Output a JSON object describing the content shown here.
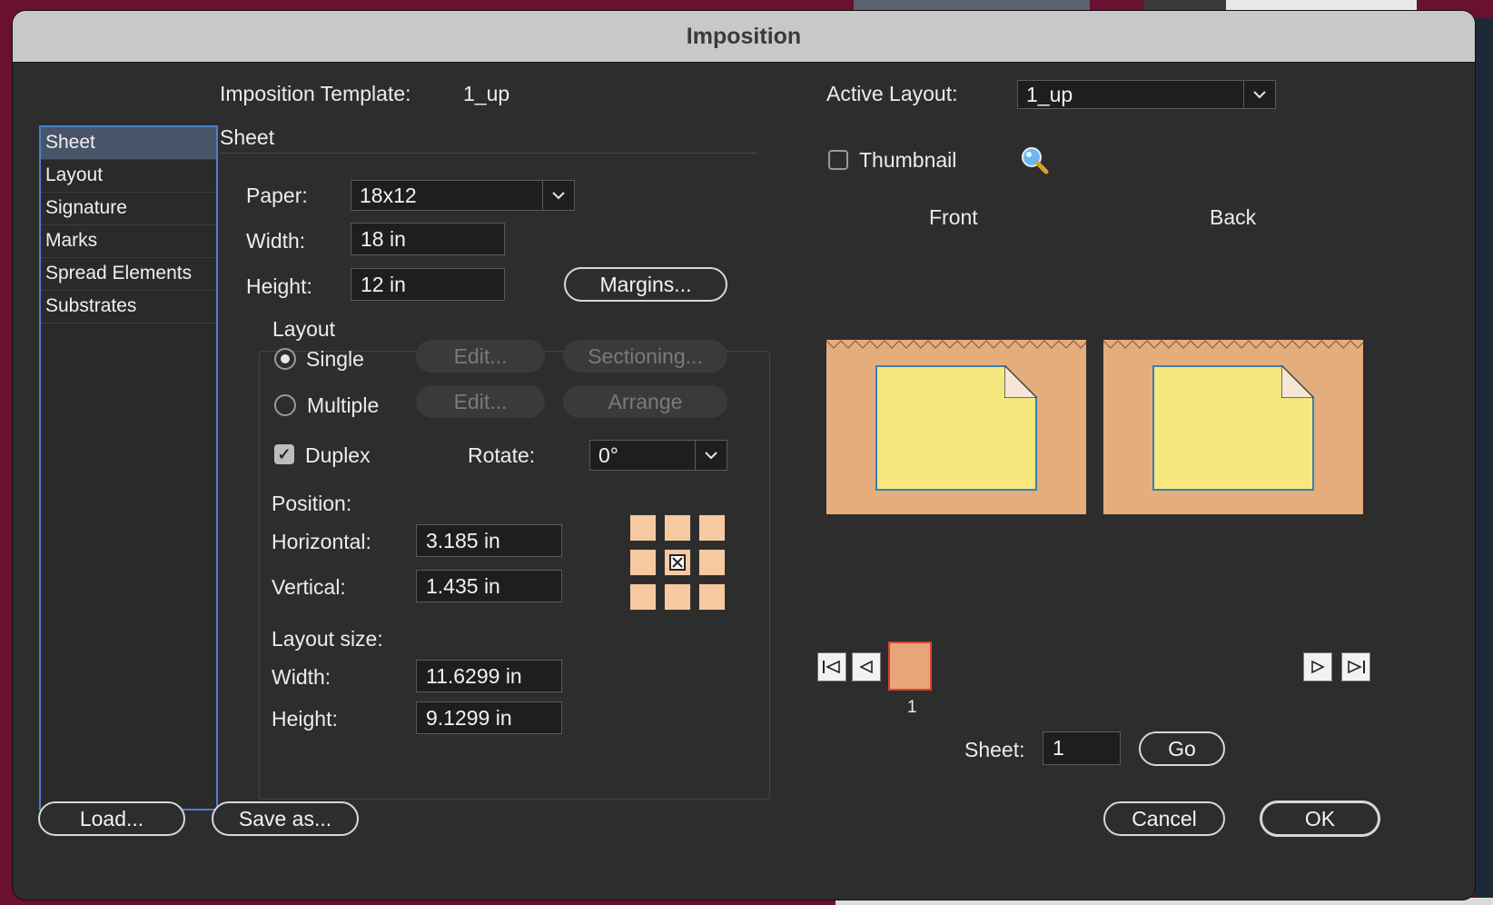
{
  "dialog": {
    "title": "Imposition"
  },
  "template": {
    "label": "Imposition Template:",
    "value": "1_up"
  },
  "active_layout": {
    "label": "Active Layout:",
    "value": "1_up"
  },
  "sidebar": {
    "items": [
      {
        "label": "Sheet",
        "active": true
      },
      {
        "label": "Layout"
      },
      {
        "label": "Signature"
      },
      {
        "label": "Marks"
      },
      {
        "label": "Spread Elements"
      },
      {
        "label": "Substrates"
      }
    ]
  },
  "section": {
    "title": "Sheet"
  },
  "paper": {
    "label": "Paper:",
    "value": "18x12"
  },
  "width": {
    "label": "Width:",
    "value": "18 in"
  },
  "height": {
    "label": "Height:",
    "value": "12 in"
  },
  "margins_button": "Margins...",
  "layout_group": {
    "title": "Layout",
    "single_label": "Single",
    "multiple_label": "Multiple",
    "edit_label": "Edit...",
    "sectioning_label": "Sectioning...",
    "arrange_label": "Arrange",
    "duplex_label": "Duplex",
    "rotate_label": "Rotate:",
    "rotate_value": "0°"
  },
  "position": {
    "title": "Position:",
    "horizontal_label": "Horizontal:",
    "horizontal_value": "3.185 in",
    "vertical_label": "Vertical:",
    "vertical_value": "1.435 in"
  },
  "layout_size": {
    "title": "Layout size:",
    "width_label": "Width:",
    "width_value": "11.6299 in",
    "height_label": "Height:",
    "height_value": "9.1299 in"
  },
  "preview": {
    "thumbnail_label": "Thumbnail",
    "front_label": "Front",
    "back_label": "Back",
    "page_number": "1",
    "sheet_label": "Sheet:",
    "sheet_value": "1",
    "go_label": "Go"
  },
  "footer": {
    "load": "Load...",
    "save_as": "Save as...",
    "cancel": "Cancel",
    "ok": "OK"
  },
  "colors": {
    "sheet_bg": "#e4ad7c",
    "page_fill": "#f6e87e",
    "page_border": "#3a7fb0",
    "accent": "#4a7fd0",
    "selected_thumb": "#e8a57a"
  }
}
